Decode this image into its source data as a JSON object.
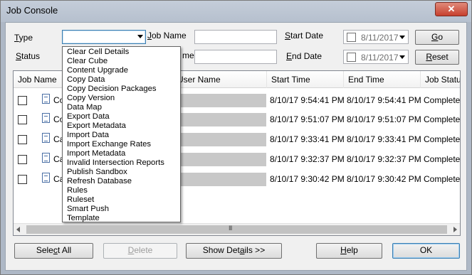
{
  "window": {
    "title": "Job Console",
    "close_glyph": "✕"
  },
  "filters": {
    "type_label_prefix": "T",
    "type_label_rest": "ype",
    "status_label_prefix": "S",
    "status_label_rest": "tatus",
    "job_name_label_prefix": "J",
    "job_name_label_rest": "ob Name",
    "user_name_label_partial": "me",
    "start_date_label_prefix": "S",
    "start_date_label_rest": "tart Date",
    "end_date_label_prefix": "E",
    "end_date_label_rest": "nd Date",
    "start_date_value": "8/11/2017",
    "end_date_value": "8/11/2017",
    "go_prefix": "G",
    "go_rest": "o",
    "reset_prefix": "R",
    "reset_rest": "eset"
  },
  "type_options": [
    "Clear Cell Details",
    "Clear Cube",
    "Content Upgrade",
    "Copy Data",
    "Copy Decision Packages",
    "Copy Version",
    "Data Map",
    "Export Data",
    "Export Metadata",
    "Import Data",
    "Import Exchange Rates",
    "Import Metadata",
    "Invalid Intersection Reports",
    "Publish Sandbox",
    "Refresh Database",
    "Rules",
    "Ruleset",
    "Smart Push",
    "Template"
  ],
  "table": {
    "columns": [
      "Job Name",
      "User Name",
      "Start Time",
      "End Time",
      "Job Status"
    ],
    "rows": [
      {
        "name": "Copy",
        "start": "8/10/17 9:54:41 PM",
        "end": "8/10/17 9:54:41 PM",
        "status": "Completed"
      },
      {
        "name": "Copy",
        "start": "8/10/17 9:51:07 PM",
        "end": "8/10/17 9:51:07 PM",
        "status": "Completed"
      },
      {
        "name": "Calc",
        "start": "8/10/17 9:33:41 PM",
        "end": "8/10/17 9:33:41 PM",
        "status": "Completed"
      },
      {
        "name": "Calc",
        "start": "8/10/17 9:32:37 PM",
        "end": "8/10/17 9:32:37 PM",
        "status": "Completed"
      },
      {
        "name": "Calc",
        "start": "8/10/17 9:30:42 PM",
        "end": "8/10/17 9:30:42 PM",
        "status": "Completed"
      }
    ],
    "scroll_grip": "III"
  },
  "buttons": {
    "select_all_pre": "Sele",
    "select_all_u": "c",
    "select_all_post": "t All",
    "delete_pre": "",
    "delete_u": "D",
    "delete_post": "elete",
    "show_details_pre": "Show Det",
    "show_details_u": "a",
    "show_details_post": "ils >>",
    "help_pre": "",
    "help_u": "H",
    "help_post": "elp",
    "ok": "OK"
  }
}
